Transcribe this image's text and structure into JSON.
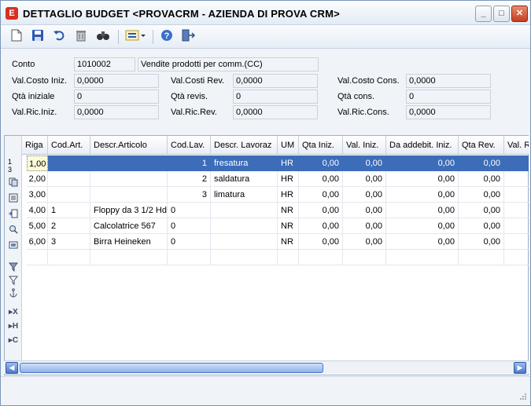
{
  "window": {
    "app_icon": "E",
    "title": "DETTAGLIO BUDGET <PROVACRM - AZIENDA DI PROVA CRM>",
    "minimize": "_",
    "maximize": "□",
    "close": "✕"
  },
  "toolbar": {
    "icons": [
      "new-icon",
      "save-icon",
      "undo-icon",
      "delete-icon",
      "find-icon",
      "filter-list-icon",
      "help-icon",
      "exit-icon"
    ]
  },
  "fields": {
    "conto_label": "Conto",
    "conto_code": "1010002",
    "conto_desc": "Vendite prodotti per comm.(CC)",
    "val_costo_iniz_label": "Val.Costo Iniz.",
    "val_costo_iniz": "0,0000",
    "qta_iniziale_label": "Qtà iniziale",
    "qta_iniziale": "0",
    "val_ric_iniz_label": "Val.Ric.Iniz.",
    "val_ric_iniz": "0,0000",
    "val_costi_rev_label": "Val.Costi Rev.",
    "val_costi_rev": "0,0000",
    "qta_revis_label": "Qtà revis.",
    "qta_revis": "0",
    "val_ric_rev_label": "Val.Ric.Rev.",
    "val_ric_rev": "0,0000",
    "val_costo_cons_label": "Val.Costo Cons.",
    "val_costo_cons": "0,0000",
    "qta_cons_label": "Qtà cons.",
    "qta_cons": "0",
    "val_ric_cons_label": "Val.Ric.Cons.",
    "val_ric_cons": "0,0000"
  },
  "grid": {
    "row_marker_top": "1",
    "row_marker_bottom": "3",
    "columns": [
      "Riga",
      "Cod.Art.",
      "Descr.Articolo",
      "Cod.Lav.",
      "Descr. Lavoraz",
      "UM",
      "Qta Iniz.",
      "Val. Iniz.",
      "Da addebit. Iniz.",
      "Qta Rev.",
      "Val. R"
    ],
    "rows": [
      [
        "1,00",
        "",
        "",
        "1",
        "fresatura",
        "HR",
        "0,00",
        "0,00",
        "0,00",
        "0,00",
        ""
      ],
      [
        "2,00",
        "",
        "",
        "2",
        "saldatura",
        "HR",
        "0,00",
        "0,00",
        "0,00",
        "0,00",
        ""
      ],
      [
        "3,00",
        "",
        "",
        "3",
        "limatura",
        "HR",
        "0,00",
        "0,00",
        "0,00",
        "0,00",
        ""
      ],
      [
        "4,00",
        "1",
        "Floppy da 3 1/2 Hd",
        "0",
        "",
        "NR",
        "0,00",
        "0,00",
        "0,00",
        "0,00",
        ""
      ],
      [
        "5,00",
        "2",
        "Calcolatrice 567",
        "0",
        "",
        "NR",
        "0,00",
        "0,00",
        "0,00",
        "0,00",
        ""
      ],
      [
        "6,00",
        "3",
        "Birra Heineken",
        "0",
        "",
        "NR",
        "0,00",
        "0,00",
        "0,00",
        "0,00",
        ""
      ],
      [
        "",
        "",
        "",
        "",
        "",
        "",
        "",
        "",
        "",
        "",
        ""
      ]
    ],
    "side_icons": [
      "copy-row-icon",
      "list-icon",
      "insert-row-icon",
      "zoom-icon",
      "image-icon",
      "filter-icon",
      "filter-remove-icon",
      "anchor-icon"
    ],
    "side_letters": [
      "▸X",
      "▸H",
      "▸C"
    ]
  },
  "scrollbar": {
    "left_arrow": "◀",
    "right_arrow": "▶"
  }
}
